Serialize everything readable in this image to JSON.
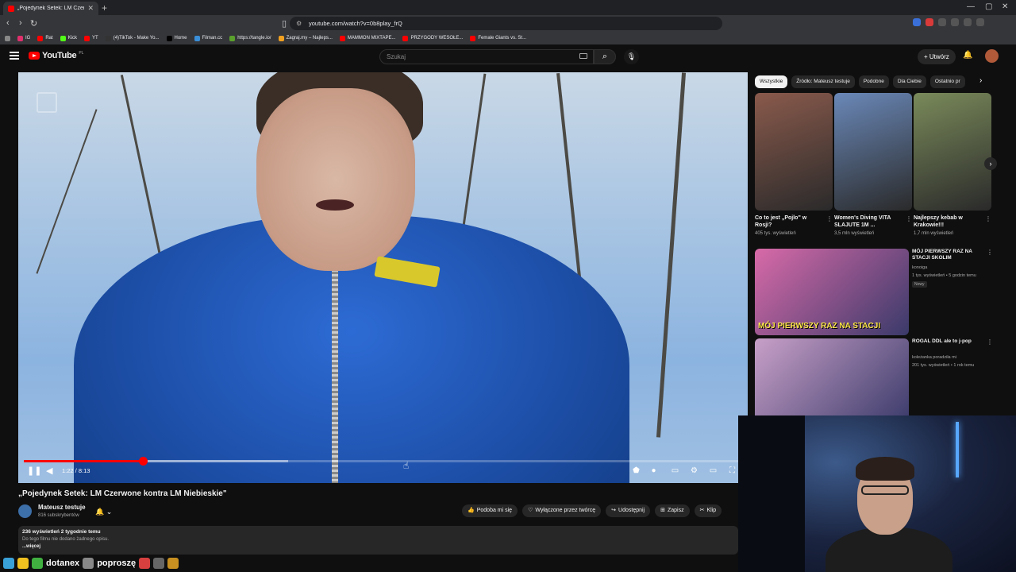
{
  "browser": {
    "tab_title": "„Pojedynek Setek: LM Czerwo",
    "url": "youtube.com/watch?v=0b8play_frQ",
    "bookmarks": [
      {
        "label": "IG",
        "color": "#e1306c"
      },
      {
        "label": "Rat",
        "color": "#ff0000"
      },
      {
        "label": "Kick",
        "color": "#53fc18"
      },
      {
        "label": "YT",
        "color": "#ff0000"
      },
      {
        "label": "(4)TikTok - Make Yo...",
        "color": "#333333"
      },
      {
        "label": "Home",
        "color": "#000000"
      },
      {
        "label": "Filman.cc",
        "color": "#3a8fd8"
      },
      {
        "label": "https://tangle.io/",
        "color": "#5aa02c"
      },
      {
        "label": "Zagraj.my – Najleps...",
        "color": "#f0a020"
      },
      {
        "label": "MAMMON MIXTAPE...",
        "color": "#ff0000"
      },
      {
        "label": "PRZYGODY WESOŁE...",
        "color": "#ff0000"
      },
      {
        "label": "Female Giants vs. St...",
        "color": "#ff0000"
      }
    ]
  },
  "masthead": {
    "logo_text": "YouTube",
    "logo_region": "PL",
    "search_placeholder": "Szukaj",
    "create_label": "Utwórz"
  },
  "player": {
    "time": "1:22 / 8:13",
    "progress": 0.1663,
    "buffered": 0.37
  },
  "video": {
    "title": "„Pojedynek Setek: LM Czerwone kontra LM Niebieskie\"",
    "channel": "Mateusz testuje",
    "subscribers": "816 subskrybentów",
    "actions": [
      {
        "icon": "👍",
        "label": "Podoba mi się"
      },
      {
        "icon": "♡",
        "label": "Wyłączone przez twórcę"
      },
      {
        "icon": "↪",
        "label": "Udostępnij"
      },
      {
        "icon": "⊞",
        "label": "Zapisz"
      },
      {
        "icon": "✂",
        "label": "Klip"
      }
    ],
    "description_meta": "236 wyświetleń  2 tygodnie temu",
    "description_body": "Do tego filmu nie dodano żadnego opisu.",
    "description_more": "...więcej"
  },
  "chips": [
    "Wszystkie",
    "Źródło: Mateusz testuje",
    "Podobne",
    "Dla Ciebie",
    "Ostatnio pr"
  ],
  "shorts": [
    {
      "title": "Co to jest „Pojlo\" w Rosji?",
      "views": "405 tys. wyświetleń",
      "color": "#8a5a4c"
    },
    {
      "title": "Women's Diving VITA SLAJUTE 1M ...",
      "views": "3,5 mln wyświetleń",
      "color": "#6a88b8"
    },
    {
      "title": "Najlepszy kebab w Krakowie!!!",
      "views": "1,7 mln wyświetleń",
      "color": "#7a8a5a"
    }
  ],
  "recommended": [
    {
      "title": "MÓJ PIERWSZY RAZ NA STACJI SKOLIM",
      "channel": "konoiga",
      "stats": "1 tys. wyświetleń • 5 godzin temu",
      "badge": "Nowy",
      "thumb_text": "MÓJ PIERWSZY RAZ NA STACJI",
      "color": "#d86aa8"
    },
    {
      "title": "ROGAL DDL ale to j-pop",
      "channel": "koleżanka poradziła mi",
      "stats": "201 tys. wyświetleń • 1 rok temu",
      "badge": "",
      "thumb_text": "",
      "color": "#c8a0c8"
    }
  ],
  "chat_strip": {
    "text1": "dotanex",
    "text2": "poproszę"
  }
}
